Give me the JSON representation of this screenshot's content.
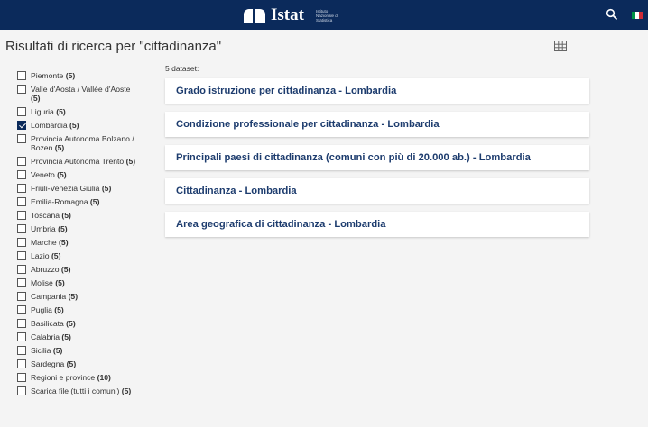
{
  "header": {
    "logo_text": "Istat",
    "logo_subtitle": "Istituto Nazionale di Statistica",
    "colors": {
      "bar": "#0b2a5b",
      "flag": [
        "#009246",
        "#ffffff",
        "#ce2b37"
      ]
    },
    "icons": [
      "istat-logo-icon",
      "search-icon",
      "italy-flag-icon"
    ]
  },
  "page": {
    "title": "Risultati di ricerca per \"cittadinanza\"",
    "dataset_count_label": "5 dataset:"
  },
  "filters": [
    {
      "label": "Piemonte",
      "count": "(5)",
      "checked": false
    },
    {
      "label": "Valle d'Aosta / Vallée d'Aoste",
      "count": "(5)",
      "checked": false
    },
    {
      "label": "Liguria",
      "count": "(5)",
      "checked": false
    },
    {
      "label": "Lombardia",
      "count": "(5)",
      "checked": true
    },
    {
      "label": "Provincia Autonoma Bolzano / Bozen",
      "count": "(5)",
      "checked": false
    },
    {
      "label": "Provincia Autonoma Trento",
      "count": "(5)",
      "checked": false
    },
    {
      "label": "Veneto",
      "count": "(5)",
      "checked": false
    },
    {
      "label": "Friuli-Venezia Giulia",
      "count": "(5)",
      "checked": false
    },
    {
      "label": "Emilia-Romagna",
      "count": "(5)",
      "checked": false
    },
    {
      "label": "Toscana",
      "count": "(5)",
      "checked": false
    },
    {
      "label": "Umbria",
      "count": "(5)",
      "checked": false
    },
    {
      "label": "Marche",
      "count": "(5)",
      "checked": false
    },
    {
      "label": "Lazio",
      "count": "(5)",
      "checked": false
    },
    {
      "label": "Abruzzo",
      "count": "(5)",
      "checked": false
    },
    {
      "label": "Molise",
      "count": "(5)",
      "checked": false
    },
    {
      "label": "Campania",
      "count": "(5)",
      "checked": false
    },
    {
      "label": "Puglia",
      "count": "(5)",
      "checked": false
    },
    {
      "label": "Basilicata",
      "count": "(5)",
      "checked": false
    },
    {
      "label": "Calabria",
      "count": "(5)",
      "checked": false
    },
    {
      "label": "Sicilia",
      "count": "(5)",
      "checked": false
    },
    {
      "label": "Sardegna",
      "count": "(5)",
      "checked": false
    },
    {
      "label": "Regioni e province",
      "count": "(10)",
      "checked": false
    },
    {
      "label": "Scarica file (tutti i comuni)",
      "count": "(5)",
      "checked": false
    }
  ],
  "results": [
    {
      "title": "Grado istruzione per cittadinanza - Lombardia"
    },
    {
      "title": "Condizione professionale per cittadinanza - Lombardia"
    },
    {
      "title": "Principali paesi di cittadinanza (comuni con più di 20.000 ab.) - Lombardia"
    },
    {
      "title": "Cittadinanza - Lombardia"
    },
    {
      "title": "Area geografica di cittadinanza - Lombardia"
    }
  ]
}
